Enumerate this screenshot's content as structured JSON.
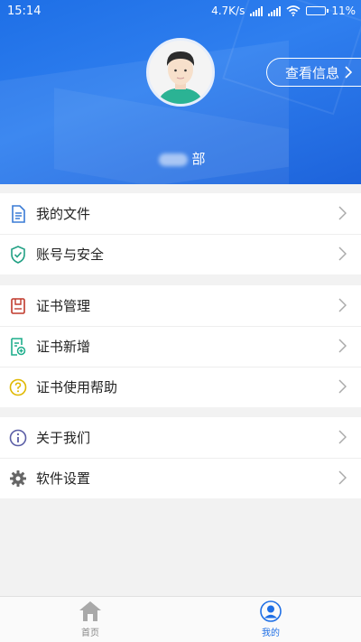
{
  "status": {
    "time": "15:14",
    "speed": "4.7K/s",
    "battery": "11%"
  },
  "profile": {
    "view_info_label": "查看信息",
    "name_suffix": "部"
  },
  "menu": {
    "group1": [
      {
        "label": "我的文件",
        "icon": "document-icon"
      },
      {
        "label": "账号与安全",
        "icon": "shield-check-icon"
      }
    ],
    "group2": [
      {
        "label": "证书管理",
        "icon": "certificate-icon"
      },
      {
        "label": "证书新增",
        "icon": "add-certificate-icon"
      },
      {
        "label": "证书使用帮助",
        "icon": "help-icon"
      }
    ],
    "group3": [
      {
        "label": "关于我们",
        "icon": "info-icon"
      },
      {
        "label": "软件设置",
        "icon": "gear-icon"
      }
    ]
  },
  "nav": {
    "home_label": "首页",
    "mine_label": "我的"
  },
  "colors": {
    "accent": "#1f6fe5",
    "header": "#2a79ec"
  }
}
